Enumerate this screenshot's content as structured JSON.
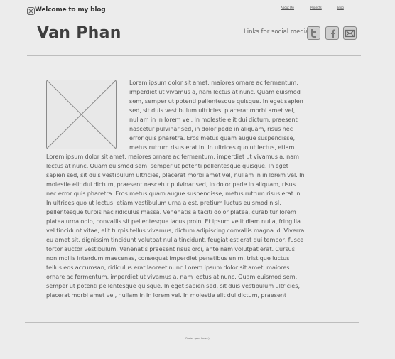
{
  "header": {
    "close_icon": "close-box-icon",
    "brand": "Welcome to my blog",
    "nav": [
      "About Me",
      "Projects",
      "Blog"
    ]
  },
  "page_title": "Van Phan",
  "social": {
    "label": "Links for social media",
    "buttons": [
      {
        "name": "twitter",
        "icon": "twitter-icon"
      },
      {
        "name": "facebook",
        "icon": "facebook-icon"
      },
      {
        "name": "email",
        "icon": "envelope-icon"
      }
    ]
  },
  "article": {
    "image_icon": "image-placeholder-icon",
    "text": "Lorem ipsum dolor sit amet, maiores ornare ac fermentum, imperdiet ut vivamus a, nam lectus at nunc. Quam euismod sem, semper ut potenti pellentesque quisque. In eget sapien sed, sit duis vestibulum ultricies, placerat morbi amet vel, nullam in in lorem vel. In molestie elit dui dictum, praesent nascetur pulvinar sed, in dolor pede in aliquam, risus nec error quis pharetra. Eros metus quam augue suspendisse, metus rutrum risus erat in.  In ultrices quo ut lectus, etiam Lorem ipsum dolor sit amet, maiores ornare ac fermentum, imperdiet ut vivamus a, nam lectus at nunc. Quam euismod sem, semper ut potenti pellentesque quisque. In eget sapien sed, sit duis vestibulum ultricies, placerat morbi amet vel, nullam in in lorem vel. In molestie elit dui dictum, praesent nascetur pulvinar sed, in dolor pede in aliquam, risus nec error quis pharetra. Eros metus quam augue suspendisse, metus rutrum risus erat in. In ultrices quo ut lectus, etiam vestibulum urna a est, pretium luctus euismod nisl, pellentesque turpis hac ridiculus massa. Venenatis a taciti dolor platea, curabitur lorem platea urna odio, convallis sit pellentesque lacus proin. Et ipsum velit diam nulla, fringilla vel tincidunt vitae, elit turpis tellus vivamus, dictum adipiscing convallis magna id. Viverra eu amet sit, dignissim tincidunt volutpat nulla tincidunt, feugiat est erat dui tempor, fusce tortor auctor vestibulum. Venenatis praesent risus orci, ante nam volutpat erat. Cursus non mollis interdum maecenas, consequat imperdiet penatibus enim, tristique luctus tellus eos accumsan, ridiculus erat laoreet nunc.Lorem ipsum dolor sit amet, maiores ornare ac fermentum, imperdiet ut vivamus a, nam lectus at nunc. Quam euismod sem, semper ut potenti pellentesque quisque. In eget sapien sed, sit duis vestibulum ultricies, placerat morbi amet vel, nullam in in lorem vel. In molestie elit dui dictum, praesent"
  },
  "footer": {
    "text": "Footer goes here :)"
  }
}
